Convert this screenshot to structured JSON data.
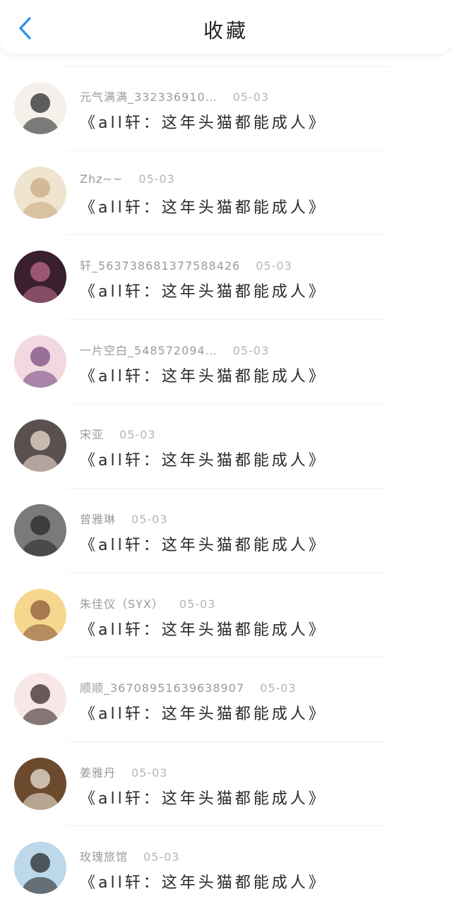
{
  "header": {
    "title": "收藏",
    "back_icon": "chevron-left-icon",
    "accent_color": "#2f8ff0"
  },
  "items": [
    {
      "user": "元气满满_332336910…",
      "date": "05-03",
      "title": "《all轩：这年头猫都能成人》",
      "avatar_colors": [
        "#f4f1ea",
        "#2b2b2b"
      ]
    },
    {
      "user": "Zhz~~",
      "date": "05-03",
      "title": "《all轩：这年头猫都能成人》",
      "avatar_colors": [
        "#efe4cf",
        "#c9ab82"
      ]
    },
    {
      "user": "轩_563738681377588426",
      "date": "05-03",
      "title": "《all轩：这年头猫都能成人》",
      "avatar_colors": [
        "#3a1f2e",
        "#b96b8a"
      ]
    },
    {
      "user": "一片空白_548572094…",
      "date": "05-03",
      "title": "《all轩：这年头猫都能成人》",
      "avatar_colors": [
        "#f2d8e0",
        "#7a4d83"
      ]
    },
    {
      "user": "宋亚",
      "date": "05-03",
      "title": "《all轩：这年头猫都能成人》",
      "avatar_colors": [
        "#5a5050",
        "#f0dcd0"
      ]
    },
    {
      "user": "曾雅琳",
      "date": "05-03",
      "title": "《all轩：这年头猫都能成人》",
      "avatar_colors": [
        "#7a7a7a",
        "#2a2a2a"
      ]
    },
    {
      "user": "朱佳仪（SYX）",
      "date": "05-03",
      "title": "《all轩：这年头猫都能成人》",
      "avatar_colors": [
        "#f6d78e",
        "#8b5a3c"
      ]
    },
    {
      "user": "顺顺_36708951639638907",
      "date": "05-03",
      "title": "《all轩：这年头猫都能成人》",
      "avatar_colors": [
        "#f7e7e6",
        "#3a2a2a"
      ]
    },
    {
      "user": "姜雅丹",
      "date": "05-03",
      "title": "《all轩：这年头猫都能成人》",
      "avatar_colors": [
        "#6b4a2e",
        "#e9e2d4"
      ]
    },
    {
      "user": "玫瑰旅馆",
      "date": "05-03",
      "title": "《all轩：这年头猫都能成人》",
      "avatar_colors": [
        "#bcd8ea",
        "#2a2a2a"
      ]
    }
  ]
}
